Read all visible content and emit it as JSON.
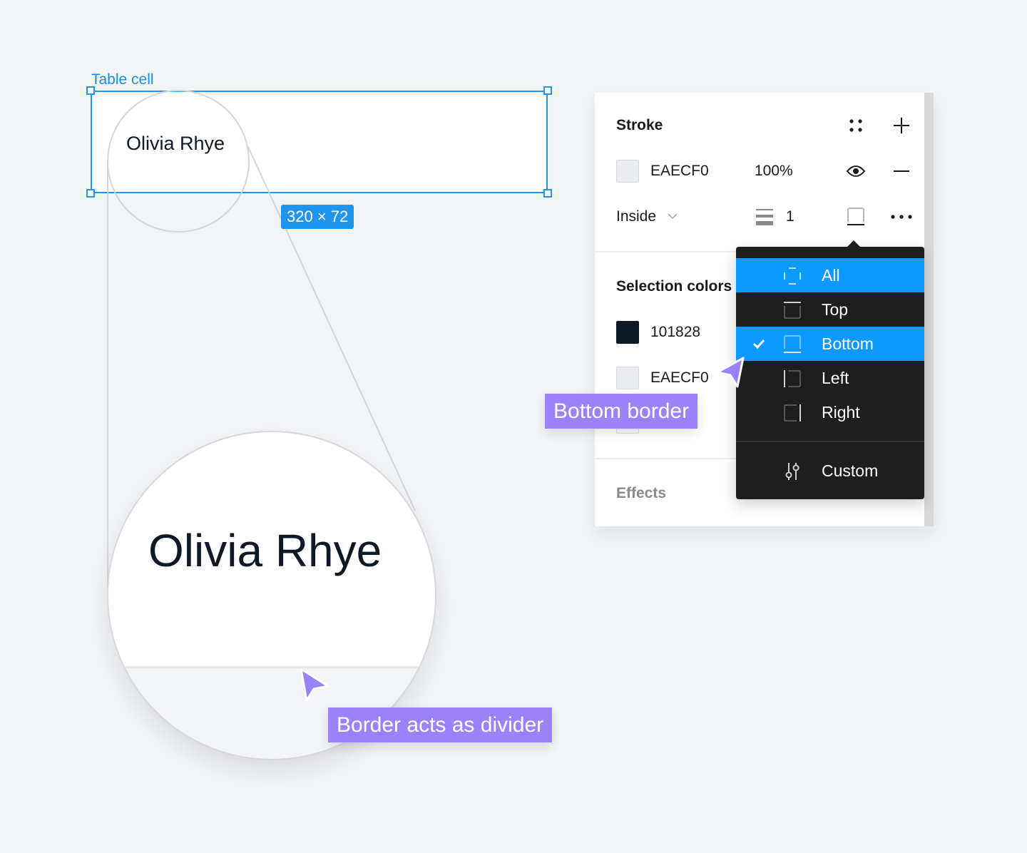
{
  "canvas": {
    "frame_label": "Table cell",
    "cell_text": "Olivia Rhye",
    "size_badge": "320 × 72",
    "magnified_text": "Olivia Rhye"
  },
  "callouts": {
    "divider": "Border acts as divider",
    "bottom_border": "Bottom border"
  },
  "panel": {
    "stroke": {
      "title": "Stroke",
      "style_icon": "grid-dots-icon",
      "add_icon": "plus-icon",
      "color_hex": "EAECF0",
      "color_value": "#EAECF0",
      "opacity": "100%",
      "visibility_icon": "eye-icon",
      "remove_icon": "minus-icon",
      "position": "Inside",
      "weight": "1",
      "side_icon": "border-bottom-icon",
      "more_icon": "more-horizontal-icon"
    },
    "selection_colors": {
      "title": "Selection colors",
      "items": [
        {
          "hex": "101828",
          "value": "#101828"
        },
        {
          "hex": "EAECF0",
          "value": "#EAECF0"
        }
      ]
    },
    "effects": {
      "title": "Effects"
    }
  },
  "dropdown": {
    "items": [
      {
        "label": "All",
        "icon": "border-all-icon",
        "hovered": true,
        "checked": false
      },
      {
        "label": "Top",
        "icon": "border-top-icon",
        "hovered": false,
        "checked": false
      },
      {
        "label": "Bottom",
        "icon": "border-bottom-icon",
        "hovered": false,
        "checked": true
      },
      {
        "label": "Left",
        "icon": "border-left-icon",
        "hovered": false,
        "checked": false
      },
      {
        "label": "Right",
        "icon": "border-right-icon",
        "hovered": false,
        "checked": false
      }
    ],
    "custom": {
      "label": "Custom",
      "icon": "sliders-icon"
    }
  },
  "colors": {
    "selection_blue": "#1E96F0",
    "menu_highlight": "#0D99FF",
    "callout_purple": "#9B82FB",
    "text_dark": "#101828"
  }
}
